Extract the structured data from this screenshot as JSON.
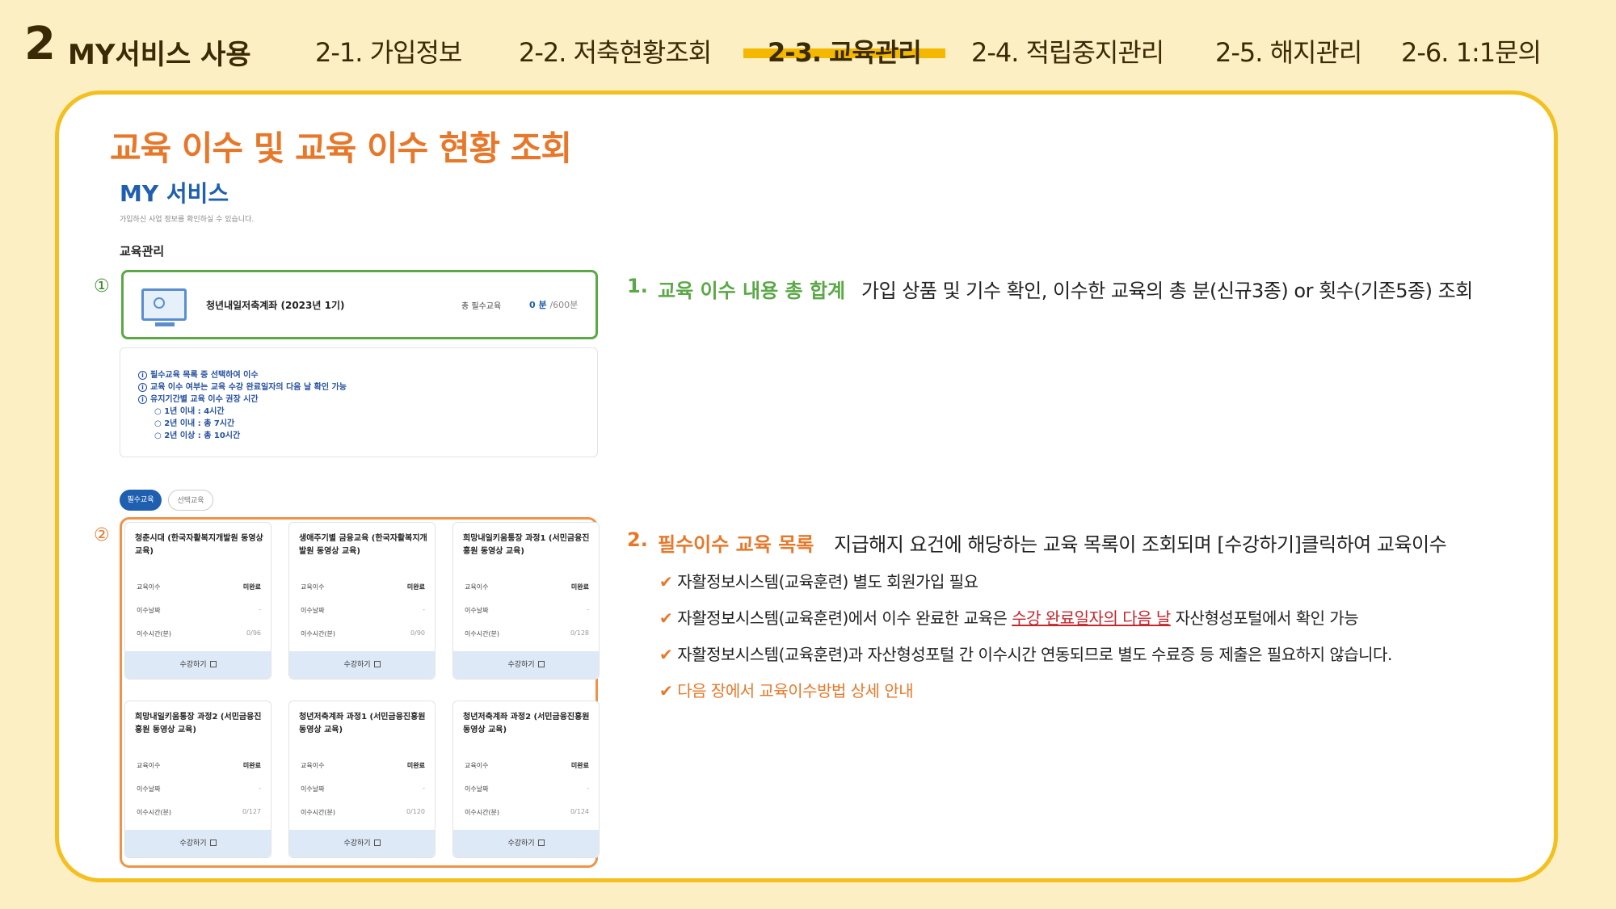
{
  "header": {
    "section_number": "2",
    "section_title": "MY서비스 사용",
    "nav": [
      {
        "label": "2-1. 가입정보",
        "active": false
      },
      {
        "label": "2-2. 저축현황조회",
        "active": false
      },
      {
        "label": "2-3. 교육관리",
        "active": true
      },
      {
        "label": "2-4. 적립중지관리",
        "active": false
      },
      {
        "label": "2-5. 해지관리",
        "active": false
      },
      {
        "label": "2-6. 1:1문의",
        "active": false
      }
    ]
  },
  "main_title": "교육 이수 및 교육 이수 현황 조회",
  "screenshot": {
    "title": "MY 서비스",
    "subtitle": "가입하신 사업 정보를 확인하실 수 있습니다.",
    "section_label": "교육관리",
    "marker1": "①",
    "marker2": "②",
    "account": {
      "name": "청년내일저축계좌 (2023년 1기)",
      "required_label": "총 필수교육",
      "minutes": "0 분",
      "minutes_total": "/600분"
    },
    "info_lines": [
      "필수교육 목록 중 선택하여 이수",
      "교육 이수 여부는 교육 수강 완료일자의 다음 날 확인 가능",
      "유지기간별 교육 이수 권장 시간",
      "○ 1년 이내 : 4시간",
      "○ 2년 이내 : 총 7시간",
      "○ 2년 이상 : 총 10시간"
    ],
    "tabs": [
      "필수교육",
      "선택교육"
    ],
    "row_labels": [
      "교육이수",
      "이수날짜",
      "이수시간(분)"
    ],
    "button_label": "수강하기",
    "cards": [
      {
        "title": "청춘시대 (한국자활복지개발원 동영상 교육)",
        "status": "미완료",
        "date": "-",
        "time": "0/96"
      },
      {
        "title": "생애주기별 금융교육 (한국자활복지개발원 동영상 교육)",
        "status": "미완료",
        "date": "-",
        "time": "0/90"
      },
      {
        "title": "희망내일키움통장 과정1 (서민금융진흥원 동영상 교육)",
        "status": "미완료",
        "date": "-",
        "time": "0/128"
      },
      {
        "title": "희망내일키움통장 과정2 (서민금융진흥원 동영상 교육)",
        "status": "미완료",
        "date": "-",
        "time": "0/127"
      },
      {
        "title": "청년저축계좌 과정1 (서민금융진흥원 동영상 교육)",
        "status": "미완료",
        "date": "-",
        "time": "0/120"
      },
      {
        "title": "청년저축계좌 과정2 (서민금융진흥원 동영상 교육)",
        "status": "미완료",
        "date": "-",
        "time": "0/124"
      }
    ]
  },
  "explanations": {
    "item1": {
      "number": "1.",
      "heading": "교육 이수 내용 총 합계",
      "description": "가입 상품 및 기수 확인, 이수한 교육의 총 분(신규3종) or 횟수(기존5종) 조회"
    },
    "item2": {
      "number": "2.",
      "heading": "필수이수 교육 목록",
      "description": "지급해지 요건에 해당하는 교육 목록이 조회되며 [수강하기]클릭하여 교육이수"
    },
    "check": "✔",
    "bullets": [
      {
        "text": "자활정보시스템(교육훈련) 별도 회원가입 필요"
      },
      {
        "pre": "자활정보시스템(교육훈련)에서 이수 완료한 교육은 ",
        "underline": "수강 완료일자의 다음 날",
        "post": " 자산형성포털에서 확인 가능"
      },
      {
        "text": "자활정보시스템(교육훈련)과 자산형성포털 간 이수시간 연동되므로 별도 수료증 등 제출은 필요하지 않습니다."
      },
      {
        "text": "다음 장에서 교육이수방법 상세 안내"
      }
    ]
  }
}
